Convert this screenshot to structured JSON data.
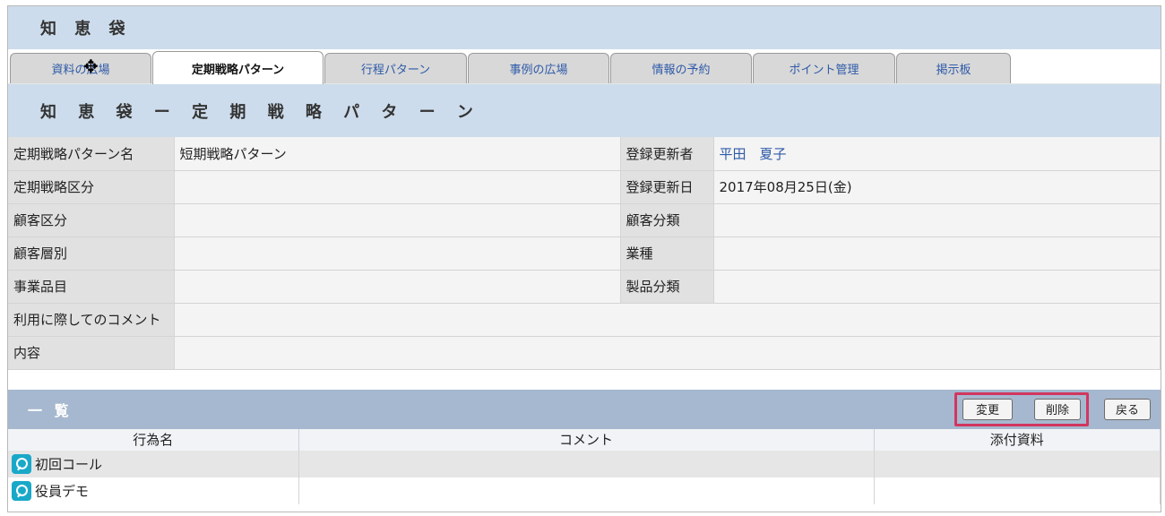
{
  "app": {
    "brand": "知 恵 袋"
  },
  "tabs": [
    {
      "label": "資料の広場",
      "active": false
    },
    {
      "label": "定期戦略パターン",
      "active": true
    },
    {
      "label": "行程パターン",
      "active": false
    },
    {
      "label": "事例の広場",
      "active": false
    },
    {
      "label": "情報の予約",
      "active": false
    },
    {
      "label": "ポイント管理",
      "active": false
    },
    {
      "label": "掲示板",
      "active": false
    }
  ],
  "section": {
    "title": "知 恵 袋 ー 定 期 戦 略 パ タ ー ン"
  },
  "details": {
    "pattern_name_label": "定期戦略パターン名",
    "pattern_name_value": "短期戦略パターン",
    "updater_label": "登録更新者",
    "updater_value": "平田　夏子",
    "category_label": "定期戦略区分",
    "category_value": "",
    "updated_date_label": "登録更新日",
    "updated_date_value": "2017年08月25日(金)",
    "customer_division_label": "顧客区分",
    "customer_division_value": "",
    "customer_class_label": "顧客分類",
    "customer_class_value": "",
    "customer_tier_label": "顧客層別",
    "customer_tier_value": "",
    "industry_label": "業種",
    "industry_value": "",
    "business_item_label": "事業品目",
    "business_item_value": "",
    "product_class_label": "製品分類",
    "product_class_value": "",
    "usage_comment_label": "利用に際してのコメント",
    "usage_comment_value": "",
    "content_label": "内容",
    "content_value": ""
  },
  "list": {
    "title": "一 覧",
    "buttons": {
      "edit": "変更",
      "delete": "削除",
      "back": "戻る"
    },
    "columns": [
      "行為名",
      "コメント",
      "添付資料"
    ],
    "rows": [
      {
        "name": "初回コール",
        "comment": "",
        "attachment": ""
      },
      {
        "name": "役員デモ",
        "comment": "",
        "attachment": ""
      }
    ]
  },
  "colors": {
    "header_bg": "#cddcec",
    "list_header_bg": "#a6b8cf",
    "highlight": "#d1365f",
    "link": "#2e5aa8",
    "action_icon": "#1aa8c9"
  }
}
